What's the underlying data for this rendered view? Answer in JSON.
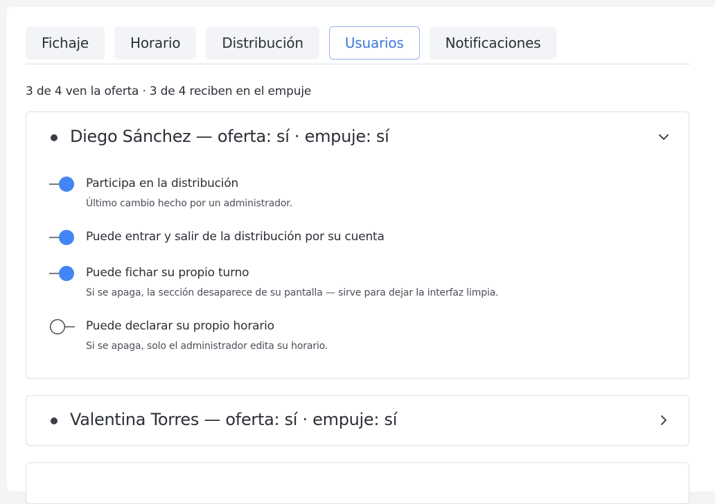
{
  "tabs": [
    {
      "label": "Fichaje",
      "active": false
    },
    {
      "label": "Horario",
      "active": false
    },
    {
      "label": "Distribución",
      "active": false
    },
    {
      "label": "Usuarios",
      "active": true
    },
    {
      "label": "Notificaciones",
      "active": false
    }
  ],
  "summary": "3 de 4 ven la oferta · 3 de 4 reciben en el empuje",
  "users": [
    {
      "title": "Diego Sánchez — oferta: sí · empuje: sí",
      "expanded": true,
      "permissions": [
        {
          "label": "Participa en la distribución",
          "description": "Último cambio hecho por un administrador.",
          "enabled": true
        },
        {
          "label": "Puede entrar y salir de la distribución por su cuenta",
          "description": "",
          "enabled": true
        },
        {
          "label": "Puede fichar su propio turno",
          "description": "Si se apaga, la sección desaparece de su pantalla — sirve para dejar la interfaz limpia.",
          "enabled": true
        },
        {
          "label": "Puede declarar su propio horario",
          "description": "Si se apaga, solo el administrador edita su horario.",
          "enabled": false
        }
      ]
    },
    {
      "title": "Valentina Torres — oferta: sí · empuje: sí",
      "expanded": false
    }
  ],
  "icons": {
    "expanded": "chevron-down-icon",
    "collapsed": "chevron-right-icon"
  },
  "colors": {
    "accent": "#3d7ad8",
    "toggle_on": "#4285f4",
    "text": "#2b2f36"
  }
}
